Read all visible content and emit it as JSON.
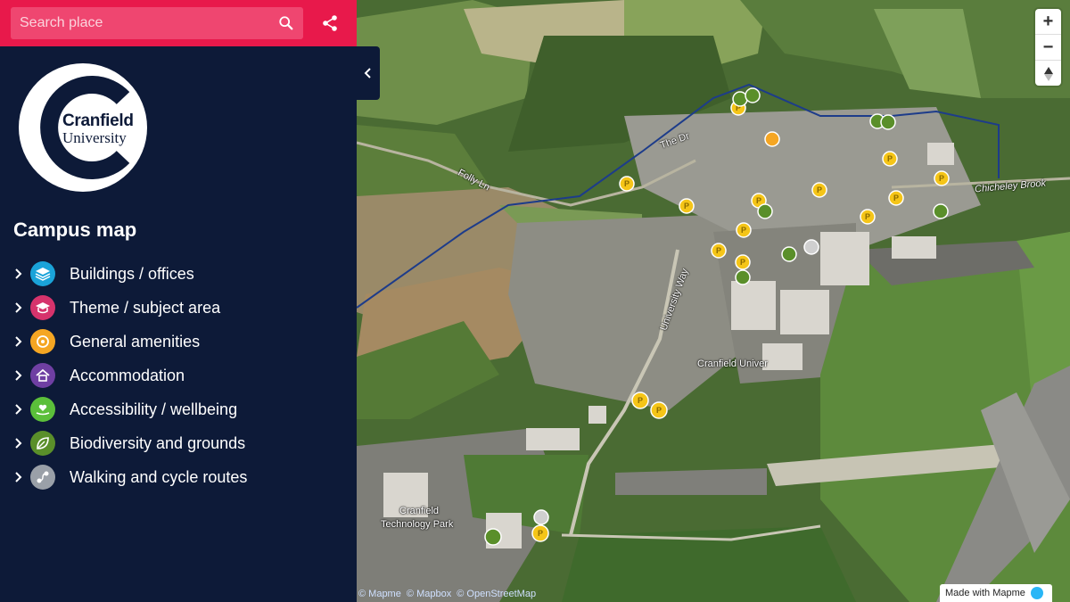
{
  "search": {
    "placeholder": "Search place"
  },
  "logo": {
    "line1": "Cranfield",
    "line2": "University"
  },
  "panel": {
    "title": "Campus map"
  },
  "categories": [
    {
      "label": "Buildings / offices",
      "icon": "layers-icon",
      "color": "#1aa3d9"
    },
    {
      "label": "Theme / subject area",
      "icon": "mortarboard-icon",
      "color": "#d6336c"
    },
    {
      "label": "General amenities",
      "icon": "amenities-icon",
      "color": "#f5a623"
    },
    {
      "label": "Accommodation",
      "icon": "house-icon",
      "color": "#6f3fa3"
    },
    {
      "label": "Accessibility / wellbeing",
      "icon": "heart-hand-icon",
      "color": "#5bbf3a"
    },
    {
      "label": "Biodiversity and grounds",
      "icon": "leaf-icon",
      "color": "#5a8f2a"
    },
    {
      "label": "Walking and cycle routes",
      "icon": "route-icon",
      "color": "#9aa0a8"
    }
  ],
  "map_labels": {
    "folly_ln": "Folly Ln",
    "the_dr": "The Dr",
    "university_way": "University Way",
    "chicheley_brook": "Chicheley Brook",
    "cranfield_univ": "Cranfield Univer",
    "tech_park_1": "Cranfield",
    "tech_park_2": "Technology Park"
  },
  "attribution": [
    "© Mapme",
    "© Mapbox",
    "© OpenStreetMap"
  ],
  "made_with": "Made with Mapme",
  "colors": {
    "sidebar": "#0d1a38",
    "searchbar": "#e8194b",
    "parking": "#f5c518",
    "nature": "#5a8f2a"
  }
}
